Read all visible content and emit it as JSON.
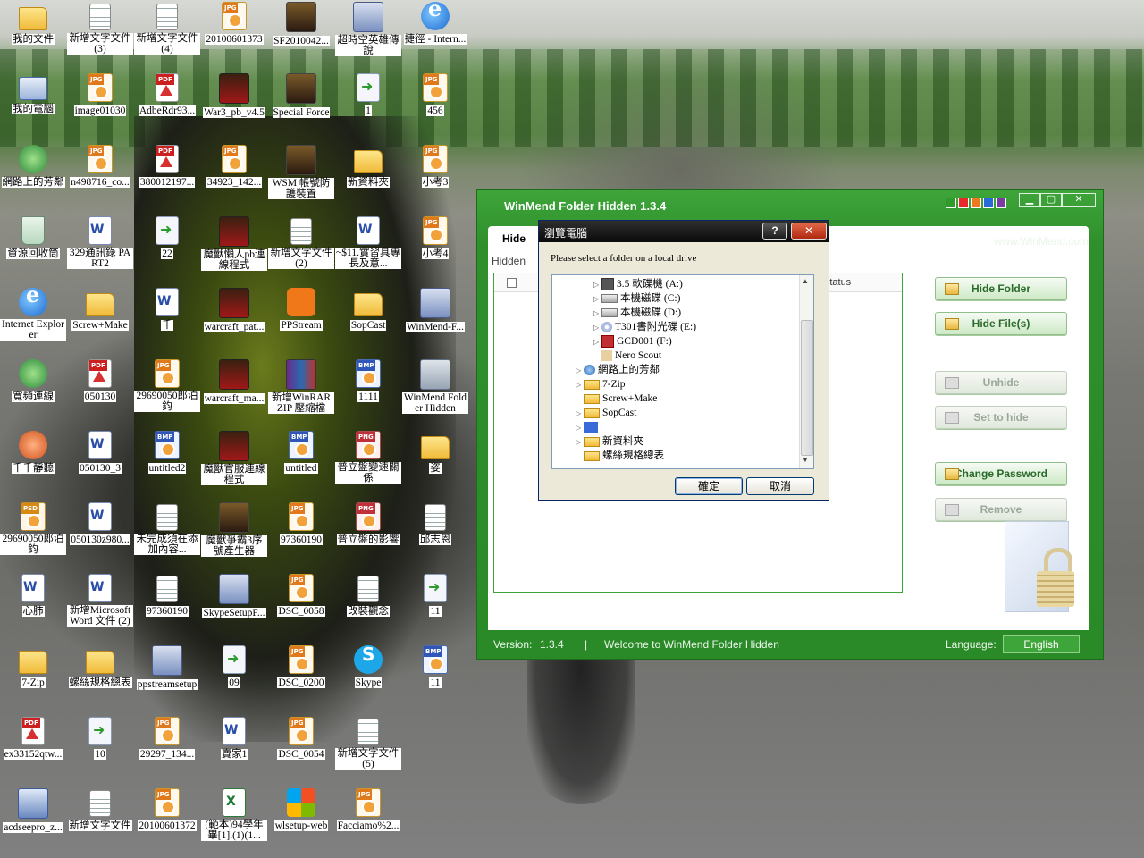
{
  "desktop": {
    "icons": [
      {
        "label": "我的文件",
        "type": "folder"
      },
      {
        "label": "新增文字文件 (3)",
        "type": "doc"
      },
      {
        "label": "新增文字文件 (4)",
        "type": "doc"
      },
      {
        "label": "20100601373",
        "type": "jpg"
      },
      {
        "label": "SF2010042...",
        "type": "exe"
      },
      {
        "label": "超時空英雄傳說",
        "type": "app"
      },
      {
        "label": "捷徑 - Intern...",
        "type": "ie"
      },
      {
        "label": "我的電腦",
        "type": "pc"
      },
      {
        "label": "image01030",
        "type": "jpg"
      },
      {
        "label": "AdbeRdr93...",
        "type": "pdf"
      },
      {
        "label": "War3_pb_v4.5",
        "type": "game"
      },
      {
        "label": "Special Force",
        "type": "exe"
      },
      {
        "label": "1",
        "type": "arrow"
      },
      {
        "label": "456",
        "type": "jpg"
      },
      {
        "label": "網路上的芳鄰",
        "type": "net"
      },
      {
        "label": "n498716_co...",
        "type": "jpg"
      },
      {
        "label": "380012197...",
        "type": "pdf"
      },
      {
        "label": "34923_142...",
        "type": "jpg"
      },
      {
        "label": "WSM 帳號防護裝置",
        "type": "exe"
      },
      {
        "label": "新資料夾",
        "type": "folder"
      },
      {
        "label": "小考3",
        "type": "jpg"
      },
      {
        "label": "資源回收筒",
        "type": "recycle"
      },
      {
        "label": "329通訊錄 PART2",
        "type": "word"
      },
      {
        "label": "22",
        "type": "arrow"
      },
      {
        "label": "魔獸懶人pb連線程式",
        "type": "game"
      },
      {
        "label": "新增文字文件 (2)",
        "type": "doc"
      },
      {
        "label": "~$11.實習具專長及意...",
        "type": "word"
      },
      {
        "label": "小考4",
        "type": "jpg"
      },
      {
        "label": "Internet Explorer",
        "type": "ie"
      },
      {
        "label": "Screw+Make",
        "type": "folder"
      },
      {
        "label": "千",
        "type": "word"
      },
      {
        "label": "warcraft_pat...",
        "type": "game"
      },
      {
        "label": "PPStream",
        "type": "pps"
      },
      {
        "label": "SopCast",
        "type": "folder"
      },
      {
        "label": "WinMend-F...",
        "type": "app"
      },
      {
        "label": "寬頻連線",
        "type": "net"
      },
      {
        "label": "050130",
        "type": "pdf"
      },
      {
        "label": "29690050郎泊鈞",
        "type": "jpg"
      },
      {
        "label": "warcraft_ma...",
        "type": "game"
      },
      {
        "label": "新增WinRAR ZIP 壓縮檔",
        "type": "zip"
      },
      {
        "label": "1111",
        "type": "bmp"
      },
      {
        "label": "WinMend Folder Hidden",
        "type": "lock"
      },
      {
        "label": "千千靜聽",
        "type": "music"
      },
      {
        "label": "050130_3",
        "type": "word"
      },
      {
        "label": "untitled2",
        "type": "bmp"
      },
      {
        "label": "魔獸官服連線程式",
        "type": "game"
      },
      {
        "label": "untitled",
        "type": "bmp"
      },
      {
        "label": "普立盤變速關係",
        "type": "png"
      },
      {
        "label": "姿",
        "type": "folder"
      },
      {
        "label": "29690050郎泊鈞",
        "type": "psd"
      },
      {
        "label": "050130z980...",
        "type": "word"
      },
      {
        "label": "未完成須在添加內容...",
        "type": "doc"
      },
      {
        "label": "魔獸爭霸3序號產生器",
        "type": "exe"
      },
      {
        "label": "97360190",
        "type": "jpg"
      },
      {
        "label": "普立盤的影響",
        "type": "png"
      },
      {
        "label": "邱志恩",
        "type": "doc"
      },
      {
        "label": "心肺",
        "type": "word"
      },
      {
        "label": "新增Microsoft Word 文件 (2)",
        "type": "word"
      },
      {
        "label": "97360190",
        "type": "doc"
      },
      {
        "label": "SkypeSetupF...",
        "type": "app"
      },
      {
        "label": "DSC_0058",
        "type": "jpg"
      },
      {
        "label": "改裝觀念",
        "type": "doc"
      },
      {
        "label": "11",
        "type": "arrow"
      },
      {
        "label": "7-Zip",
        "type": "folder"
      },
      {
        "label": "螺絲規格總表",
        "type": "folder"
      },
      {
        "label": "ppstreamsetup",
        "type": "app"
      },
      {
        "label": "09",
        "type": "arrow"
      },
      {
        "label": "DSC_0200",
        "type": "jpg"
      },
      {
        "label": "Skype",
        "type": "skype"
      },
      {
        "label": "11",
        "type": "bmp"
      },
      {
        "label": "ex33152qtw...",
        "type": "pdf"
      },
      {
        "label": "10",
        "type": "arrow"
      },
      {
        "label": "29297_134...",
        "type": "jpg"
      },
      {
        "label": "賣家1",
        "type": "word"
      },
      {
        "label": "DSC_0054",
        "type": "jpg"
      },
      {
        "label": "新增文字文件 (5)",
        "type": "doc"
      },
      {
        "label": "",
        "type": "none"
      },
      {
        "label": "acdseepro_z...",
        "type": "acd"
      },
      {
        "label": "新增文字文件",
        "type": "doc"
      },
      {
        "label": "20100601372",
        "type": "jpg"
      },
      {
        "label": "(範本)94學年畢[1].(1)(1...",
        "type": "xls"
      },
      {
        "label": "wlsetup-web",
        "type": "win"
      },
      {
        "label": "Facciamo%2...",
        "type": "jpg"
      },
      {
        "label": "",
        "type": "none"
      }
    ]
  },
  "winmend": {
    "title": "WinMend Folder Hidden 1.3.4",
    "theme_colors": [
      "#2e9b2a",
      "#e82a2a",
      "#f07820",
      "#2a6ad8",
      "#7a3aa8"
    ],
    "controls": {
      "minimize": "▁",
      "maximize": "▢",
      "close": "✕"
    },
    "url": "www.WinMend.com",
    "tab_hide": "Hide",
    "hidden_label": "Hidden",
    "list_header_status": "Status",
    "buttons": {
      "hide_folder": "Hide Folder",
      "hide_files": "Hide File(s)",
      "unhide": "Unhide",
      "set_to_hide": "Set to hide",
      "change_password": "Change Password",
      "remove": "Remove"
    },
    "footer": {
      "version_label": "Version:",
      "version": "1.3.4",
      "separator": "|",
      "welcome": "Welcome to WinMend Folder Hidden",
      "language_label": "Language:",
      "language": "English"
    }
  },
  "browse_dialog": {
    "title": "瀏覽電腦",
    "help_button": "?",
    "close_button": "✕",
    "message": "Please select a folder on a local drive",
    "tree": [
      {
        "label": "3.5 軟碟機 (A:)",
        "icon": "floppy",
        "level": 2,
        "expander": "▷"
      },
      {
        "label": "本機磁碟 (C:)",
        "icon": "drive",
        "level": 2,
        "expander": "▷"
      },
      {
        "label": "本機磁碟 (D:)",
        "icon": "drive",
        "level": 2,
        "expander": "▷"
      },
      {
        "label": "T301書附光碟 (E:)",
        "icon": "cd",
        "level": 2,
        "expander": "▷"
      },
      {
        "label": "GCD001 (F:)",
        "icon": "redcd",
        "level": 2,
        "expander": "▷"
      },
      {
        "label": "Nero Scout",
        "icon": "nero",
        "level": 2,
        "expander": ""
      },
      {
        "label": "網路上的芳鄰",
        "icon": "net",
        "level": 1,
        "expander": "▷"
      },
      {
        "label": "7-Zip",
        "icon": "fold",
        "level": 1,
        "expander": "▷"
      },
      {
        "label": "Screw+Make",
        "icon": "fold",
        "level": 1,
        "expander": ""
      },
      {
        "label": "SopCast",
        "icon": "fold",
        "level": 1,
        "expander": "▷"
      },
      {
        "label": "",
        "icon": "sel",
        "level": 1,
        "expander": "▷"
      },
      {
        "label": "新資料夾",
        "icon": "fold",
        "level": 1,
        "expander": "▷"
      },
      {
        "label": "螺絲規格總表",
        "icon": "fold",
        "level": 1,
        "expander": ""
      }
    ],
    "scroll": {
      "up": "▲",
      "down": "▼"
    },
    "ok": "確定",
    "cancel": "取消"
  }
}
